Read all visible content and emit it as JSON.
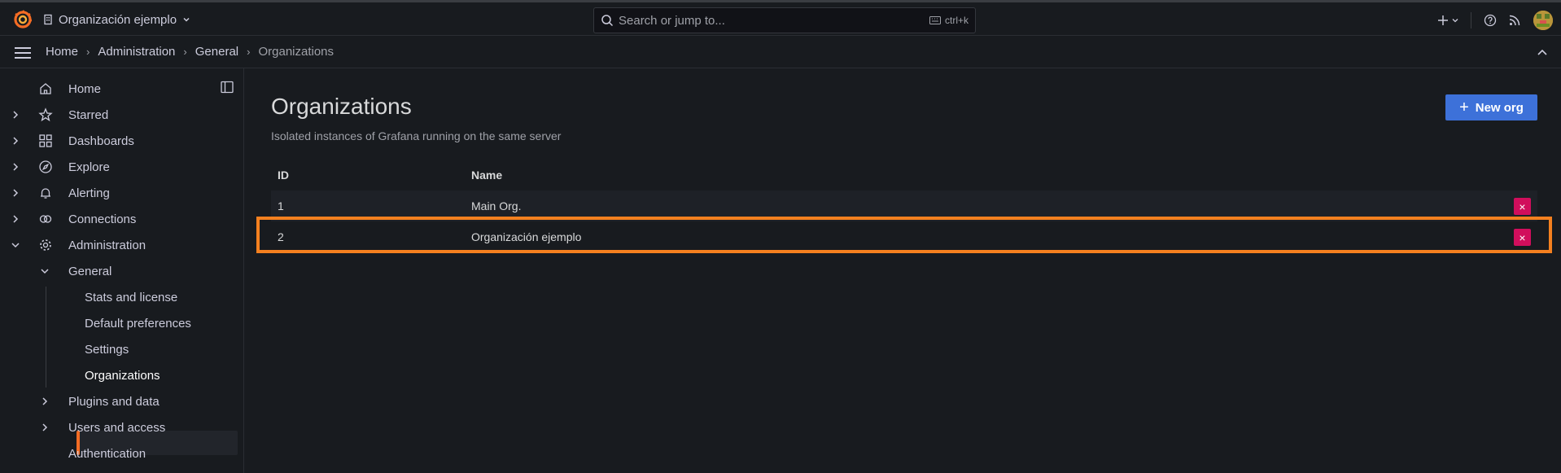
{
  "topbar": {
    "org_name": "Organización ejemplo",
    "search_placeholder": "Search or jump to...",
    "search_shortcut": "ctrl+k"
  },
  "breadcrumb": [
    "Home",
    "Administration",
    "General",
    "Organizations"
  ],
  "sidebar": {
    "items": [
      {
        "label": "Home",
        "icon": "home-icon",
        "has_chevron": false
      },
      {
        "label": "Starred",
        "icon": "star-icon",
        "has_chevron": true
      },
      {
        "label": "Dashboards",
        "icon": "apps-icon",
        "has_chevron": true
      },
      {
        "label": "Explore",
        "icon": "compass-icon",
        "has_chevron": true
      },
      {
        "label": "Alerting",
        "icon": "bell-icon",
        "has_chevron": true
      },
      {
        "label": "Connections",
        "icon": "link-icon",
        "has_chevron": true
      },
      {
        "label": "Administration",
        "icon": "cog-icon",
        "has_chevron": true,
        "expanded": true
      }
    ],
    "general_label": "General",
    "general_children": [
      "Stats and license",
      "Default preferences",
      "Settings",
      "Organizations"
    ],
    "active_child": "Organizations",
    "plugins_label": "Plugins and data",
    "users_label": "Users and access",
    "auth_label": "Authentication"
  },
  "page": {
    "title": "Organizations",
    "subtitle": "Isolated instances of Grafana running on the same server",
    "new_button_label": "New org"
  },
  "table": {
    "columns": [
      "ID",
      "Name"
    ],
    "rows": [
      {
        "id": "1",
        "name": "Main Org."
      },
      {
        "id": "2",
        "name": "Organización ejemplo",
        "highlighted": true
      }
    ],
    "delete_glyph": "×"
  },
  "colors": {
    "accent_orange": "#f46c24",
    "primary_blue": "#3d71d9",
    "danger": "#d10e5c",
    "highlight_border": "#f4801f"
  }
}
